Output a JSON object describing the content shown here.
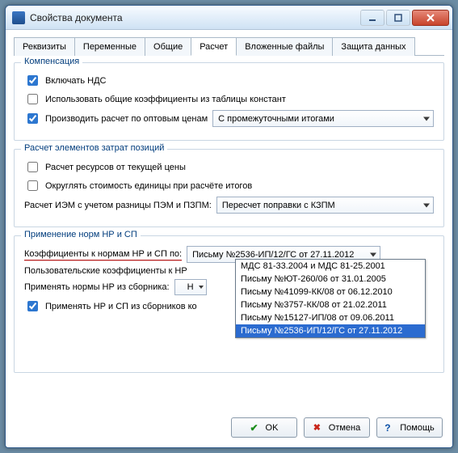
{
  "window": {
    "title": "Свойства документа"
  },
  "tabs": {
    "items": [
      {
        "label": "Реквизиты"
      },
      {
        "label": "Переменные"
      },
      {
        "label": "Общие"
      },
      {
        "label": "Расчет"
      },
      {
        "label": "Вложенные файлы"
      },
      {
        "label": "Защита данных"
      }
    ],
    "active": 3
  },
  "compensation": {
    "legend": "Компенсация",
    "include_vat": "Включать НДС",
    "use_global_coeffs": "Использовать общие коэффициенты из таблицы констант",
    "wholesale_calc": "Производить расчет по оптовым ценам",
    "wholesale_select": "С промежуточными итогами"
  },
  "cost_elements": {
    "legend": "Расчет элементов затрат позиций",
    "calc_from_current_price": "Расчет ресурсов от текущей цены",
    "round_unit_cost": "Округлять стоимость единицы при расчёте итогов",
    "iem_label": "Расчет ИЭМ с учетом разницы ПЭМ и ПЗПМ:",
    "iem_select": "Пересчет поправки с КЗПМ"
  },
  "nr_sp": {
    "legend": "Применение норм НР и СП",
    "coeff_label": "Коэффициенты к нормам НР и СП по:",
    "coeff_select": "Письму №2536-ИП/12/ГС от 27.11.2012",
    "custom_coeffs": "Пользовательские коэффициенты к НР",
    "apply_from_collection": "Применять нормы НР из сборника:",
    "small_select_value": "Н",
    "apply_from_collections_checkbox": "Применять НР и СП из сборников ко",
    "dropdown_options": [
      "МДС 81-33.2004 и МДС 81-25.2001",
      "Письму №ЮТ-260/06 от 31.01.2005",
      "Письму №41099-КК/08 от 06.12.2010",
      "Письму №3757-КК/08 от 21.02.2011",
      "Письму №15127-ИП/08 от 09.06.2011",
      "Письму №2536-ИП/12/ГС от 27.11.2012"
    ],
    "dropdown_selected": 5
  },
  "buttons": {
    "ok": "OK",
    "cancel": "Отмена",
    "help": "Помощь"
  }
}
